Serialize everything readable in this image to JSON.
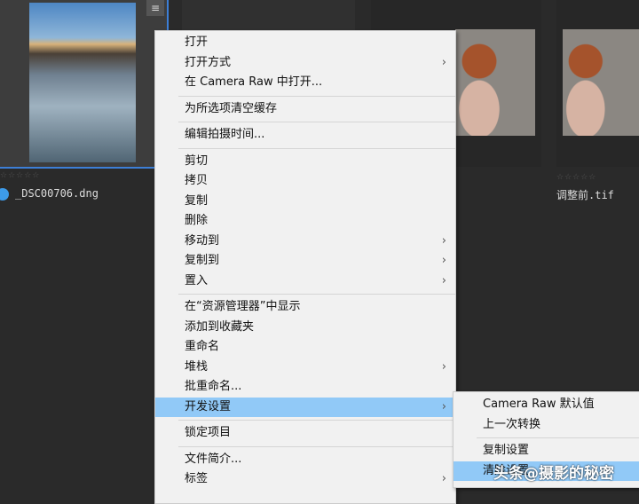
{
  "thumbnails": [
    {
      "filename": "_DSC00706.dng",
      "rating": "☆☆☆☆☆",
      "label_color": "#3d9be9"
    },
    {
      "filename": "调整前.tif",
      "rating": "☆☆☆☆☆"
    }
  ],
  "filter_icon": "sliders-icon",
  "context_menu": [
    {
      "label": "打开"
    },
    {
      "label": "打开方式",
      "arrow": "›"
    },
    {
      "label": "在 Camera Raw 中打开..."
    },
    {
      "label": "为所选项清空缓存"
    },
    {
      "label": "编辑拍摄时间..."
    },
    {
      "label": "剪切"
    },
    {
      "label": "拷贝"
    },
    {
      "label": "复制"
    },
    {
      "label": "删除"
    },
    {
      "label": "移动到",
      "arrow": "›"
    },
    {
      "label": "复制到",
      "arrow": "›"
    },
    {
      "label": "置入",
      "arrow": "›"
    },
    {
      "label": "在“资源管理器”中显示"
    },
    {
      "label": "添加到收藏夹"
    },
    {
      "label": "重命名"
    },
    {
      "label": "堆栈",
      "arrow": "›"
    },
    {
      "label": "批重命名..."
    },
    {
      "label": "开发设置",
      "arrow": "›"
    },
    {
      "label": "锁定项目"
    },
    {
      "label": "文件简介..."
    },
    {
      "label": "标签",
      "arrow": "›"
    }
  ],
  "submenu": [
    {
      "label": "Camera Raw 默认值"
    },
    {
      "label": "上一次转换"
    },
    {
      "label": "复制设置"
    },
    {
      "label": "清除设置"
    }
  ],
  "watermark": "头条@摄影的秘密"
}
